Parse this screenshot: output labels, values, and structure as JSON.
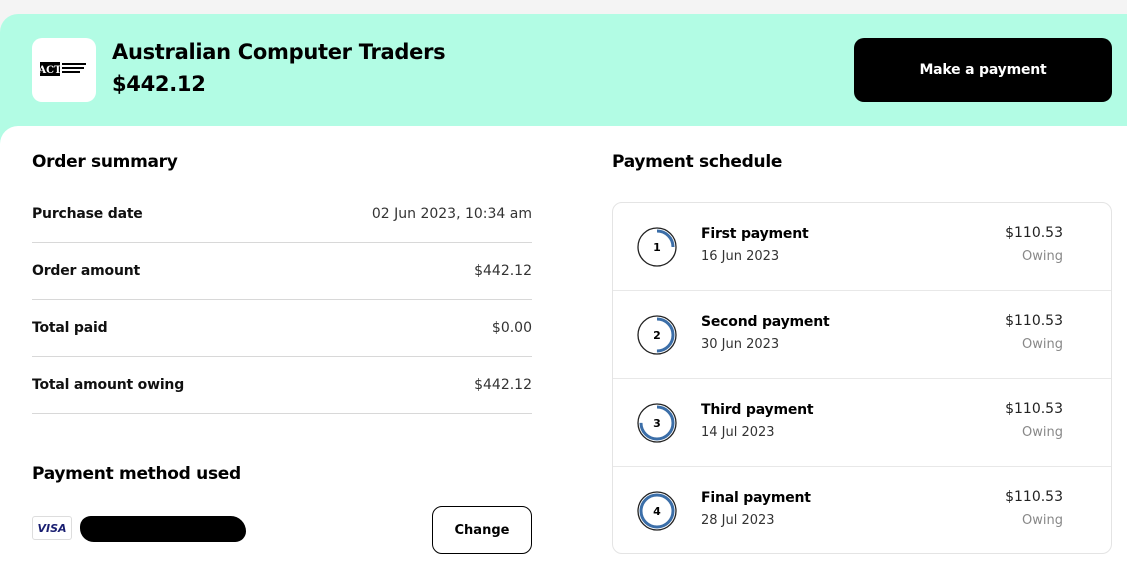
{
  "merchant": {
    "name": "Australian Computer Traders",
    "amount": "$442.12",
    "logo_text": "ACT"
  },
  "actions": {
    "make_payment": "Make a payment",
    "change": "Change"
  },
  "order_summary": {
    "title": "Order summary",
    "rows": [
      {
        "label": "Purchase date",
        "value": "02 Jun 2023, 10:34 am"
      },
      {
        "label": "Order amount",
        "value": "$442.12"
      },
      {
        "label": "Total paid",
        "value": "$0.00"
      },
      {
        "label": "Total amount owing",
        "value": "$442.12"
      }
    ]
  },
  "payment_method": {
    "title": "Payment method used",
    "card_brand": "VISA"
  },
  "schedule": {
    "title": "Payment schedule",
    "items": [
      {
        "step": "1",
        "fraction": 0.25,
        "title": "First payment",
        "date": "16 Jun 2023",
        "amount": "$110.53",
        "status": "Owing"
      },
      {
        "step": "2",
        "fraction": 0.5,
        "title": "Second payment",
        "date": "30 Jun 2023",
        "amount": "$110.53",
        "status": "Owing"
      },
      {
        "step": "3",
        "fraction": 0.75,
        "title": "Third payment",
        "date": "14 Jul 2023",
        "amount": "$110.53",
        "status": "Owing"
      },
      {
        "step": "4",
        "fraction": 1.0,
        "title": "Final payment",
        "date": "28 Jul 2023",
        "amount": "$110.53",
        "status": "Owing"
      }
    ]
  },
  "colors": {
    "banner": "#b2fce4",
    "progress_ring": "#3b6ea8",
    "ring_track": "#222222"
  }
}
